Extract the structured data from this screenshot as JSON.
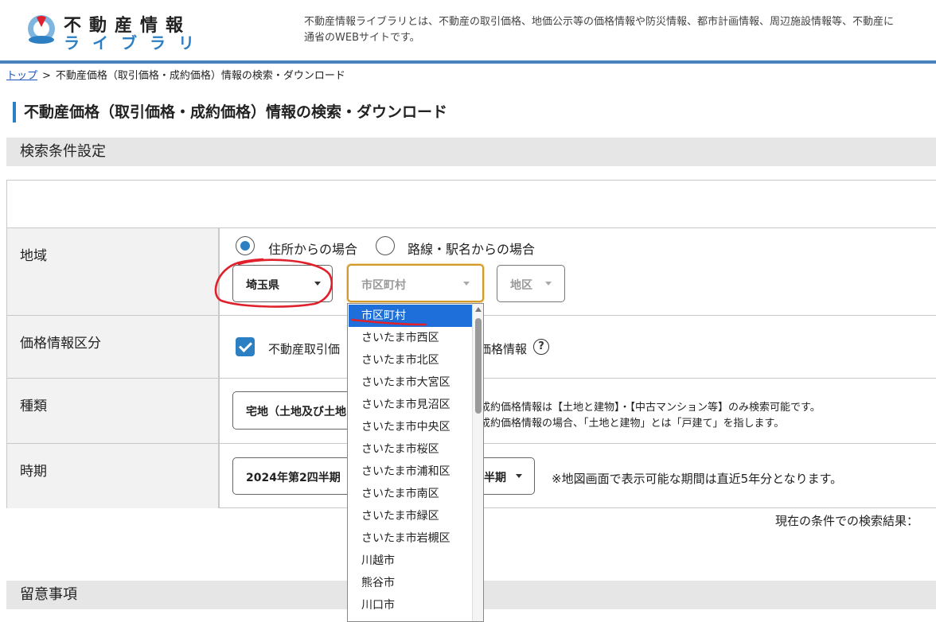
{
  "header": {
    "logo_line1": "不動産情報",
    "logo_line2": "ライブラリ",
    "description_line1": "不動産情報ライブラリとは、不動産の取引価格、地価公示等の価格情報や防災情報、都市計画情報、周辺施設情報等、不動産に",
    "description_line2": "通省のWEBサイトです。"
  },
  "breadcrumb": {
    "top": "トップ",
    "separator": ">",
    "current": "不動産価格（取引価格・成約価格）情報の検索・ダウンロード"
  },
  "page_title": "不動産価格（取引価格・成約価格）情報の検索・ダウンロード",
  "section_search": "検索条件設定",
  "section_notes": "留意事項",
  "form": {
    "region": {
      "label": "地域",
      "radio_address": "住所からの場合",
      "radio_station": "路線・駅名からの場合",
      "prefecture": "埼玉県",
      "city": "市区町村",
      "district": "地区"
    },
    "price_type": {
      "label": "価格情報区分",
      "checkbox1": "不動産取引価",
      "checkbox2_tail": "価格情報"
    },
    "kind": {
      "label": "種類",
      "select_value": "宅地（土地及び土地",
      "note1": "成約価格情報は【土地と建物】・【中古マンション等】のみ検索可能です。",
      "note2": "成約価格情報の場合、「土地と建物」とは「戸建て」を指します。"
    },
    "period": {
      "label": "時期",
      "from": "2024年第2四半期",
      "to_tail": "半期",
      "note": "※地図画面で表示可能な期間は直近5年分となります。"
    }
  },
  "result_text": "現在の条件での検索結果：",
  "dropdown": {
    "options": [
      "市区町村",
      "さいたま市西区",
      "さいたま市北区",
      "さいたま市大宮区",
      "さいたま市見沼区",
      "さいたま市中央区",
      "さいたま市桜区",
      "さいたま市浦和区",
      "さいたま市南区",
      "さいたま市緑区",
      "さいたま市岩槻区",
      "川越市",
      "熊谷市",
      "川口市"
    ],
    "selected_index": 0
  },
  "colors": {
    "accent": "#2c7fc3",
    "highlight": "#1e6fd9",
    "annotation": "#e0202a",
    "focus": "#d29a2a"
  }
}
